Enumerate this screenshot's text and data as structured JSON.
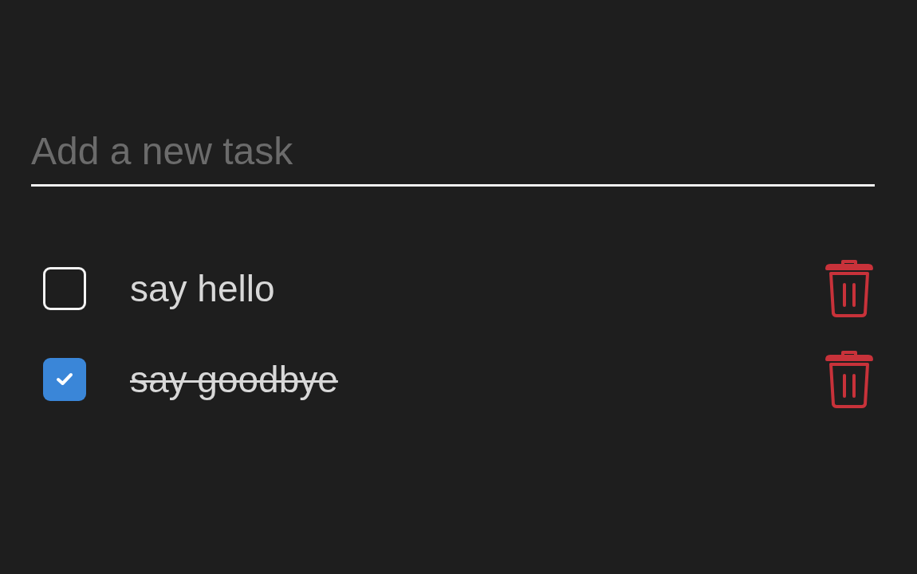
{
  "new_task": {
    "placeholder": "Add a new task"
  },
  "tasks": [
    {
      "text": "say hello",
      "checked": false
    },
    {
      "text": "say goodbye",
      "checked": true
    }
  ]
}
